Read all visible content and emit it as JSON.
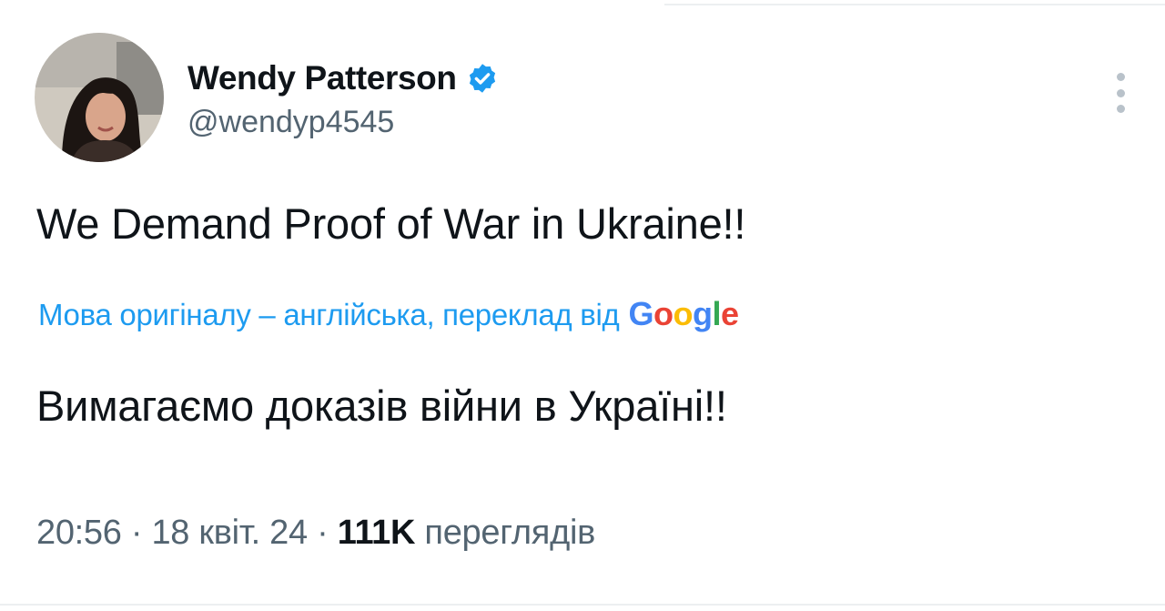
{
  "author": {
    "display_name": "Wendy Patterson",
    "handle": "@wendyp4545",
    "verified": true,
    "avatar_icon": "user-photo"
  },
  "tweet": {
    "text": "We Demand Proof of War in Ukraine!!",
    "translation_label": "Мова оригіналу – англійська, переклад від",
    "translation_provider": "Google",
    "translated_text": "Вимагаємо доказів війни в Україні!!"
  },
  "meta": {
    "time": "20:56",
    "separator1": " · ",
    "date": "18 квіт. 24",
    "separator2": " · ",
    "views_count": "111K",
    "views_label": " переглядів"
  },
  "colors": {
    "accent": "#1d9bf0",
    "text_primary": "#0f1419",
    "text_secondary": "#536471"
  },
  "icons": {
    "verified": "verified-badge-icon",
    "more": "more-vertical-icon"
  }
}
